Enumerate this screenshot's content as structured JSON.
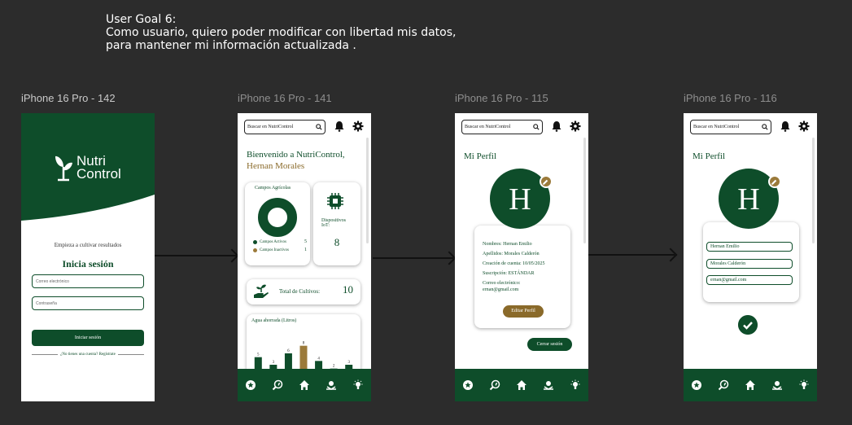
{
  "user_goal": {
    "title": "User Goal 6:",
    "line1": "Como usuario, quiero poder modificar con libertad mis datos,",
    "line2": "para mantener mi información actualizada ."
  },
  "frames": [
    {
      "label": "iPhone 16 Pro - 142"
    },
    {
      "label": "iPhone 16 Pro - 141"
    },
    {
      "label": "iPhone 16 Pro - 115"
    },
    {
      "label": "iPhone 16 Pro - 116"
    }
  ],
  "login": {
    "brand_line1": "Nutri",
    "brand_line2": "Control",
    "tagline": "Empieza a cultivar resultados",
    "title": "Inicia sesión",
    "email_placeholder": "Correo electrónico",
    "password_placeholder": "Contraseña",
    "button": "Iniciar sesión",
    "signup": "¿No tienes una cuenta? Regístrate"
  },
  "search": {
    "placeholder": "Buscar en NutriControl"
  },
  "dashboard": {
    "welcome": "Bienvenido a NutriControl,",
    "user_name": "Hernan Morales",
    "fields_title": "Campos Agrícolas",
    "active_label": "Campos Activos",
    "active_value": "5",
    "inactive_label": "Campos Inactivos",
    "inactive_value": "1",
    "iot_label": "Dispositivos IoT:",
    "iot_value": "8",
    "crops_label": "Total de Cultivos:",
    "crops_value": "10",
    "water_title": "Agua ahorrada (Litros)"
  },
  "chart_data": {
    "type": "bar",
    "title": "Agua ahorrada (Litros)",
    "categories": [
      "1",
      "2",
      "3",
      "4",
      "5",
      "6",
      "7"
    ],
    "values": [
      5,
      3,
      6,
      8,
      4,
      2,
      3
    ],
    "highlight_index": 3,
    "colors": {
      "bar": "#0e4d2a",
      "highlight": "#9b7a3a"
    }
  },
  "profile": {
    "title": "Mi Perfil",
    "avatar_letter": "H",
    "nombres": "Nombres: Hernan Emilio",
    "apellidos": "Apellidos: Morales Calderón",
    "creacion": "Creación de cuenta: 10/05/2025",
    "suscripcion": "Suscripción: ESTÁNDAR",
    "correo_label": "Correo electrónico:",
    "correo": "ernan@gmail.com",
    "edit_button": "Editar Perfil",
    "logout_button": "Cerrar sesión"
  },
  "edit": {
    "nombres_value": "Hernan Emilio",
    "apellidos_value": "Morales Calderón",
    "correo_value": "ernan@gmail.com"
  },
  "nav_icons": [
    "star-icon",
    "search-leaf-icon",
    "home-icon",
    "pest-icon",
    "bulb-icon"
  ],
  "colors": {
    "primary": "#0e4d2a",
    "accent": "#9b7a3a",
    "background": "#2c2c2c"
  }
}
